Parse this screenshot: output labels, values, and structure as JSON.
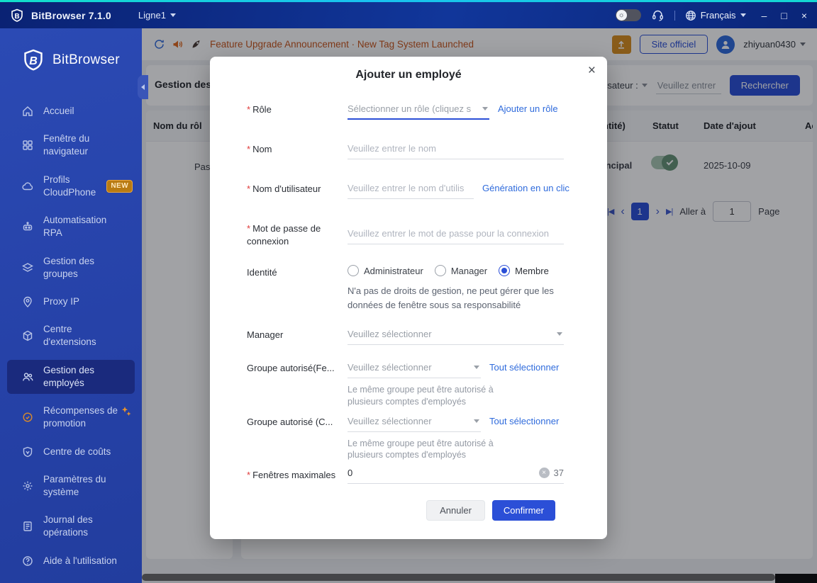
{
  "colors": {
    "accent": "#2b4fd7",
    "link": "#2f6bdc",
    "announcement_text": "#c9571e",
    "sidebar_bg": "#2642a8",
    "sidebar_active_bg": "#1a2a7d",
    "warning_orange": "#d98f1f",
    "topbar_bg": "#0d2b85",
    "cyan_edge": "#14d8d2"
  },
  "titlebar": {
    "brand": "BitBrowser 7.1.0",
    "line": "Ligne1",
    "language": "Français",
    "minimize": "–",
    "maximize": "□",
    "close": "×"
  },
  "announcement": {
    "text": "Feature Upgrade Announcement · New Tag System Launched",
    "site_button": "Site officiel",
    "username": "zhiyuan0430"
  },
  "sidebar": {
    "brand": "BitBrowser",
    "new_badge": "NEW",
    "items": [
      {
        "label": "Accueil"
      },
      {
        "label": "Fenêtre du navigateur"
      },
      {
        "label": "Profils CloudPhone"
      },
      {
        "label": "Automatisation RPA"
      },
      {
        "label": "Gestion des groupes"
      },
      {
        "label": "Proxy IP"
      },
      {
        "label": "Centre d'extensions"
      },
      {
        "label": "Gestion des employés"
      },
      {
        "label": "Récompenses de promotion"
      },
      {
        "label": "Centre de coûts"
      },
      {
        "label": "Paramètres du système"
      },
      {
        "label": "Journal des opérations"
      },
      {
        "label": "Aide à l'utilisation"
      }
    ]
  },
  "page": {
    "title": "Gestion des r",
    "search_label": "utilisateur :",
    "search_placeholder": "Veuillez entrer",
    "search_button": "Rechercher",
    "left_table": {
      "header": "Nom du rôl",
      "cell": "Pas"
    },
    "table": {
      "col_identity": "ntité)",
      "col_status": "Statut",
      "col_date": "Date d'ajout",
      "col_action": "Ac",
      "row_name": "incipal",
      "row_date": "2025-10-09"
    },
    "pagination": {
      "first": "|◀",
      "prev": "‹",
      "current": "1",
      "next": "›",
      "last": "▶|",
      "goto": "Aller à",
      "value": "1",
      "page": "Page"
    }
  },
  "modal": {
    "title": "Ajouter un employé",
    "close": "×",
    "req_mark": "*",
    "role": {
      "label": "Rôle",
      "placeholder": "Sélectionner un rôle (cliquez s",
      "link": "Ajouter un rôle"
    },
    "name": {
      "label": "Nom",
      "placeholder": "Veuillez entrer le nom"
    },
    "username": {
      "label": "Nom d'utilisateur",
      "placeholder": "Veuillez entrer le nom d'utilis",
      "link": "Génération en un clic"
    },
    "password": {
      "label": "Mot de passe de connexion",
      "placeholder": "Veuillez entrer le mot de passe pour la connexion"
    },
    "identity": {
      "label": "Identité",
      "options": [
        "Administrateur",
        "Manager",
        "Membre"
      ],
      "selected": "Membre",
      "help": "N'a pas de droits de gestion, ne peut gérer que les données de fenêtre sous sa responsabilité"
    },
    "manager": {
      "label": "Manager",
      "placeholder": "Veuillez sélectionner"
    },
    "group_window": {
      "label": "Groupe autorisé(Fe...",
      "placeholder": "Veuillez sélectionner",
      "link": "Tout sélectionner",
      "help": "Le même groupe peut être autorisé à plusieurs comptes d'employés"
    },
    "group_cloud": {
      "label": "Groupe autorisé (C...",
      "placeholder": "Veuillez sélectionner",
      "link": "Tout sélectionner",
      "help": "Le même groupe peut être autorisé à plusieurs comptes d'employés"
    },
    "max_windows": {
      "label": "Fenêtres maximales",
      "value": "0",
      "counter": "37"
    },
    "cancel": "Annuler",
    "confirm": "Confirmer"
  }
}
